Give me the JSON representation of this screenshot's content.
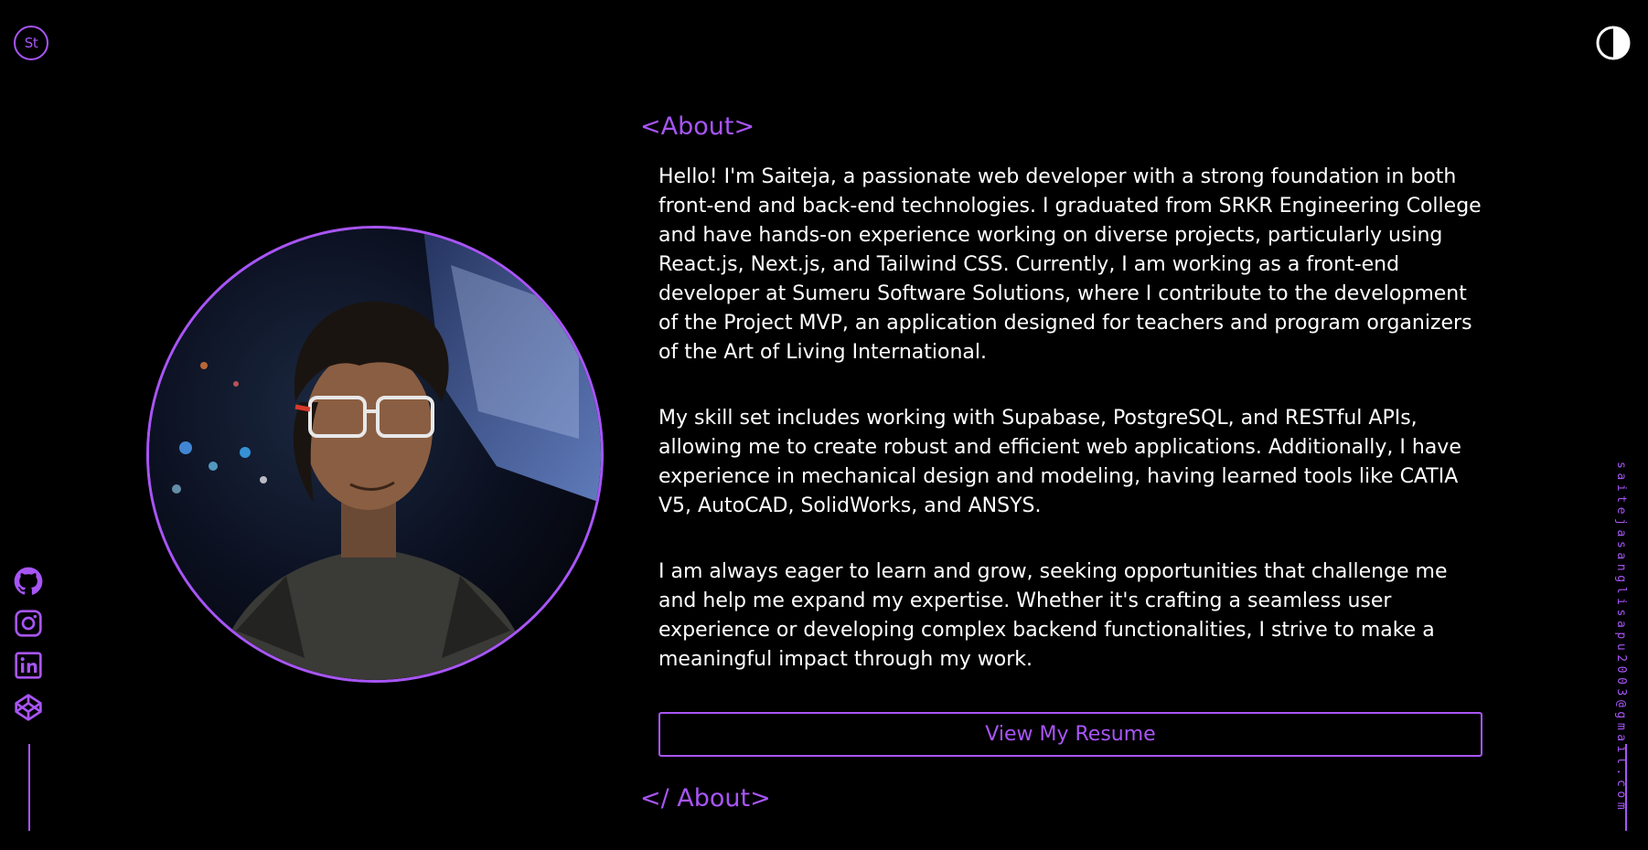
{
  "brand": {
    "logo_text": "St",
    "accent_color": "#a855f7"
  },
  "header": {
    "theme_toggle_icon": "contrast-icon"
  },
  "social": {
    "items": [
      {
        "name": "GitHub",
        "icon": "github-icon"
      },
      {
        "name": "Instagram",
        "icon": "instagram-icon"
      },
      {
        "name": "LinkedIn",
        "icon": "linkedin-icon"
      },
      {
        "name": "CodePen",
        "icon": "codepen-icon"
      }
    ]
  },
  "contact": {
    "email": "saitejasanglisapu2003@gmail.com"
  },
  "about": {
    "open_tag": "<About>",
    "close_tag": "</ About>",
    "paragraphs": [
      "Hello! I'm Saiteja, a passionate web developer with a strong foundation in both front-end and back-end technologies. I graduated from SRKR Engineering College and have hands-on experience working on diverse projects, particularly using React.js, Next.js, and Tailwind CSS. Currently, I am working as a front-end developer at Sumeru Software Solutions, where I contribute to the development of the Project MVP, an application designed for teachers and program organizers of the Art of Living International.",
      "My skill set includes working with Supabase, PostgreSQL, and RESTful APIs, allowing me to create robust and efficient web applications. Additionally, I have experience in mechanical design and modeling, having learned tools like CATIA V5, AutoCAD, SolidWorks, and ANSYS.",
      "I am always eager to learn and grow, seeking opportunities that challenge me and help me expand my expertise. Whether it's crafting a seamless user experience or developing complex backend functionalities, I strive to make a meaningful impact through my work."
    ],
    "resume_button": "View My Resume"
  }
}
